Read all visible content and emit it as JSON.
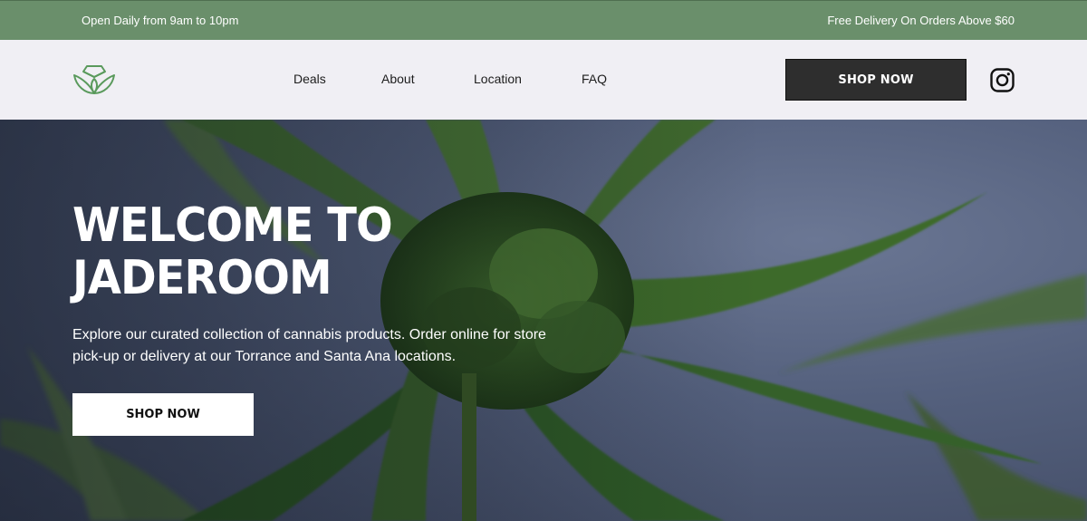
{
  "topbar": {
    "hours": "Open Daily from 9am to 10pm",
    "delivery": "Free Delivery On Orders Above $60"
  },
  "header": {
    "logo_icon": "lotus-diamond-logo",
    "nav": [
      "Deals",
      "About",
      "Location",
      "FAQ"
    ],
    "shop_button": "SHOP NOW",
    "social_icon": "instagram-icon"
  },
  "hero": {
    "title": "WELCOME TO JADEROOM",
    "description": "Explore our curated collection of cannabis products. Order online for store pick-up or delivery at our Torrance and Santa Ana locations.",
    "shop_button": "SHOP NOW",
    "background_image": "cannabis-plant-photo"
  },
  "colors": {
    "topbar_bg": "#6a8f6b",
    "brand_green": "#5a9a5c",
    "header_bg": "#f0eff4",
    "dark_button": "#2e2e2e"
  }
}
